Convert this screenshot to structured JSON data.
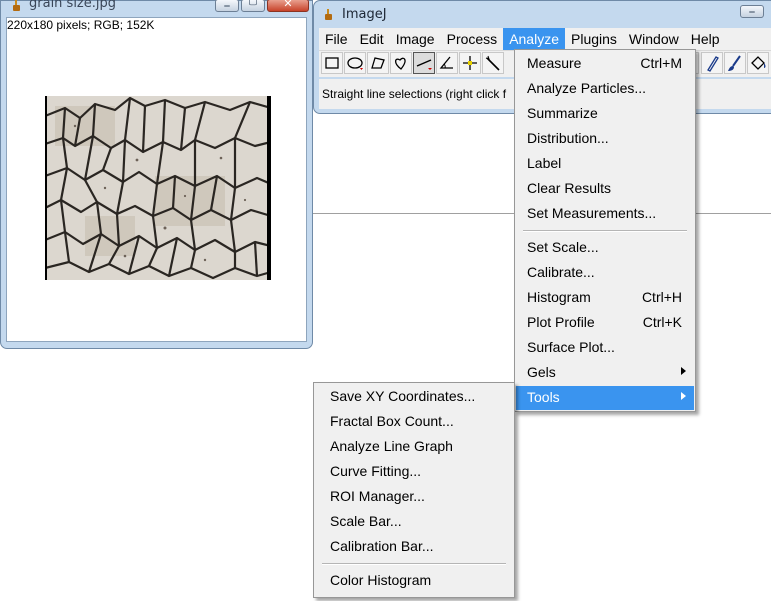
{
  "image_window": {
    "title": "grain size.jpg",
    "info": "220x180 pixels; RGB; 152K",
    "image_name": "grain-micrograph"
  },
  "main_window": {
    "title": "ImageJ",
    "menubar": [
      "File",
      "Edit",
      "Image",
      "Process",
      "Analyze",
      "Plugins",
      "Window",
      "Help"
    ],
    "active_menu": "Analyze",
    "tools": [
      "rectangle-tool-icon",
      "oval-tool-icon",
      "polygon-tool-icon",
      "freehand-tool-icon",
      "straight-line-tool-icon",
      "angle-tool-icon",
      "point-tool-icon",
      "wand-tool-icon"
    ],
    "right_tools": [
      "text-tool-icon",
      "pencil-tool-icon",
      "brush-tool-icon",
      "flood-fill-tool-icon"
    ],
    "status": "Straight line selections (right click f"
  },
  "analyze_menu": {
    "items": [
      {
        "label": "Measure",
        "shortcut": "Ctrl+M"
      },
      {
        "label": "Analyze Particles...",
        "shortcut": ""
      },
      {
        "label": "Summarize",
        "shortcut": ""
      },
      {
        "label": "Distribution...",
        "shortcut": ""
      },
      {
        "label": "Label",
        "shortcut": ""
      },
      {
        "label": "Clear Results",
        "shortcut": ""
      },
      {
        "label": "Set Measurements...",
        "shortcut": ""
      },
      {
        "label": "Set Scale...",
        "shortcut": ""
      },
      {
        "label": "Calibrate...",
        "shortcut": ""
      },
      {
        "label": "Histogram",
        "shortcut": "Ctrl+H"
      },
      {
        "label": "Plot Profile",
        "shortcut": "Ctrl+K"
      },
      {
        "label": "Surface Plot...",
        "shortcut": ""
      },
      {
        "label": "Gels",
        "shortcut": ""
      },
      {
        "label": "Tools",
        "shortcut": ""
      }
    ],
    "highlighted": "Tools"
  },
  "tools_submenu": {
    "items": [
      "Save XY Coordinates...",
      "Fractal Box Count...",
      "Analyze Line Graph",
      "Curve Fitting...",
      "ROI Manager...",
      "Scale Bar...",
      "Calibration Bar...",
      "Color Histogram"
    ]
  },
  "colors": {
    "highlight": "#3a94ef",
    "window_frame": "#c4d9ee",
    "menu_bg": "#f0f0f0"
  }
}
